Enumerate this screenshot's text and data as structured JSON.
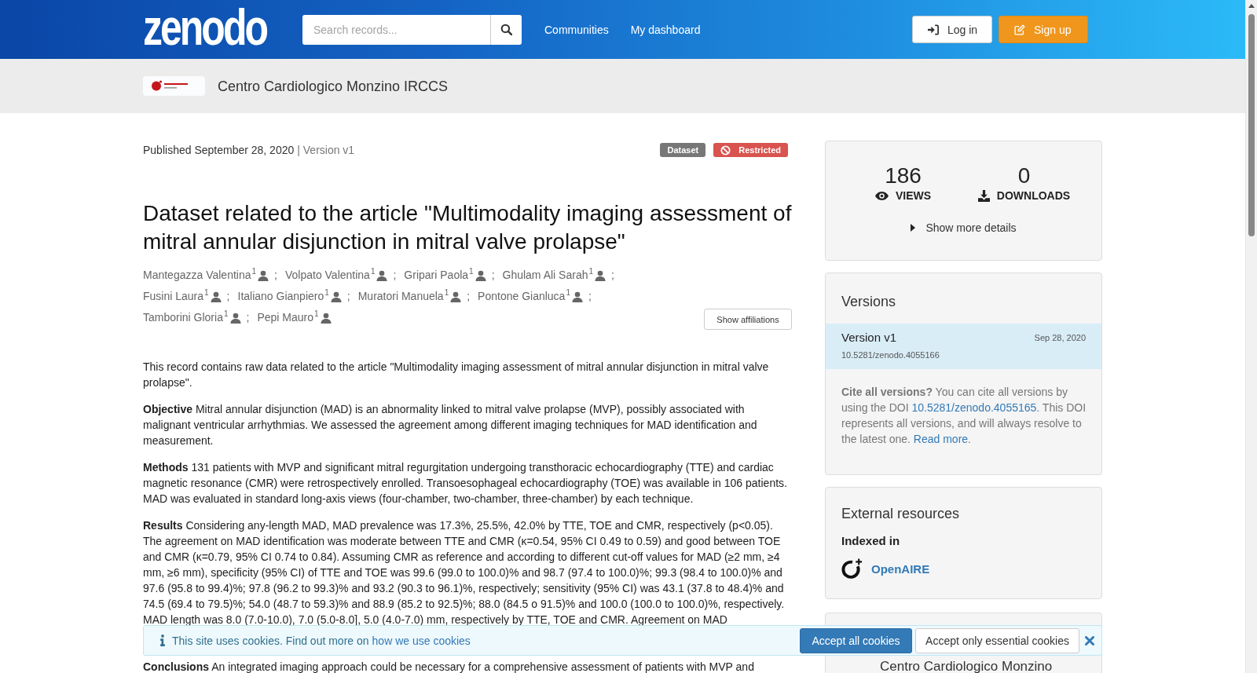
{
  "header": {
    "logo": "zenodo",
    "search": {
      "placeholder": "Search records..."
    },
    "nav": [
      {
        "label": "Communities"
      },
      {
        "label": "My dashboard"
      }
    ],
    "buttons": [
      {
        "label": "Log in",
        "kind": "login"
      },
      {
        "label": "Sign up",
        "kind": "signup"
      }
    ]
  },
  "community_bar": {
    "title": "Centro Cardiologico Monzino IRCCS"
  },
  "record": {
    "published": "Published September 28, 2020",
    "version": "| Version v1",
    "badges": [
      {
        "label": "Dataset",
        "kind": "resource_type",
        "color": "#777777"
      },
      {
        "label": "Restricted",
        "kind": "access",
        "color": "#d9534f"
      }
    ],
    "title": "Dataset related to the article \"Multimodality imaging assessment of mitral annular disjunction in mitral valve prolapse\"",
    "authors": [
      {
        "name": "Mantegazza Valentina$^{1}$",
        "separator": ";"
      },
      {
        "name": "Volpato Valentina$^{1}$",
        "separator": ";"
      },
      {
        "name": "Gripari Paola$^{1}$",
        "separator": ";"
      },
      {
        "name": "Ghulam Ali Sarah$^{1}$",
        "separator": ";"
      },
      {
        "name": "Fusini Laura$^{1}$",
        "separator": ";"
      },
      {
        "name": "Italiano Gianpiero$^{1}$",
        "separator": ";"
      },
      {
        "name": "Muratori Manuela$^{1}$",
        "separator": ";"
      },
      {
        "name": "Pontone Gianluca$^{1}$",
        "separator": ";"
      },
      {
        "name": "Tamborini Gloria$^{1}$",
        "separator": ";"
      },
      {
        "name": "Pepi Mauro$^{1}$"
      }
    ],
    "affiliations_button": "Show affiliations",
    "description": [
      "This record contains raw data related to the article \"Multimodality imaging assessment of mitral annular disjunction in mitral valve prolapse\".",
      "**Objective** Mitral annular disjunction (MAD) is an abnormality linked to mitral valve prolapse (MVP), possibly associated with malignant ventricular arrhythmias. We assessed the agreement among different imaging techniques for MAD identification and measurement.",
      "**Methods** 131 patients with MVP and significant mitral regurgitation undergoing transthoracic echocardiography (TTE) and cardiac magnetic resonance (CMR) were retrospectively enrolled. Transoesophageal echocardiography (TOE) was available in 106 patients. MAD was evaluated in standard long-axis views (four-chamber, two-chamber, three-chamber) by each technique.",
      "**Results** Considering any-length MAD, MAD prevalence was 17.3%, 25.5%, 42.0% by TTE, TOE and CMR, respectively (p<0.05). The agreement on MAD identification was moderate between TTE and CMR (κ=0.54, 95% CI 0.49 to 0.59) and good between TOE and CMR (κ=0.79, 95% CI 0.74 to 0.84). Assuming CMR as reference and according to different cut-off values for MAD (≥2 mm, ≥4 mm, ≥6 mm), specificity (95% CI) of TTE and TOE was 99.6 (99.0 to 100.0)% and 98.7 (97.4 to 100.0)%; 99.3 (98.4 to 100.0)% and 97.6 (95.8 to 99.4)%; 97.8 (96.2 to 99.3)% and 93.2 (90.3 to 96.1)%, respectively; sensitivity (95% CI) was 43.1 (37.8 to 48.4)% and 74.5 (69.4 to 79.5)%; 54.0 (48.7 to 59.3)% and 88.9 (85.2 to 92.5)%; 88.0 (84.5 o 91.5)% and 100.0 (100.0 to 100.0)%, respectively. MAD length was 8.0 (7.0-10.0), 7.0 (5.0-8.0], 5.0 (4.0-7.0) mm, respectively by TTE, TOE and CMR. Agreement on MAD"
    ],
    "conclusions": "**Conclusions** An integrated imaging approach could be necessary for a comprehensive assessment of patients with MVP and"
  },
  "stats": [
    {
      "value": "186",
      "label": "VIEWS",
      "kind": "views"
    },
    {
      "value": "0",
      "label": "DOWNLOADS",
      "kind": "downloads"
    }
  ],
  "details_toggle": {
    "label": "Show more details",
    "expanded": false
  },
  "versions": {
    "title": "Versions",
    "items": [
      {
        "title": "Version v1",
        "date": "Sep 28, 2020",
        "doi": "10.5281/zenodo.4055166",
        "selected": true
      }
    ],
    "cite_note": {
      "lead": "Cite all versions?",
      "text": "You can cite all versions by using the DOI",
      "doi_link": "10.5281/zenodo.4055165",
      "text_after": ". This DOI represents all versions, and will always resolve to the latest one.",
      "read_more": "Read more",
      "end": "."
    }
  },
  "external_resources": {
    "title": "External resources",
    "subtitle": "Indexed in",
    "links": [
      {
        "label": "OpenAIRE"
      }
    ]
  },
  "lower_card": {
    "title": "Centro Cardiologico Monzino"
  },
  "cookie_banner": {
    "text": "This site uses cookies. Find out more on",
    "link": "how we use cookies",
    "buttons": [
      {
        "label": "Accept all cookies",
        "kind": "accept_all"
      },
      {
        "label": "Accept only essential cookies",
        "kind": "essential"
      }
    ]
  }
}
